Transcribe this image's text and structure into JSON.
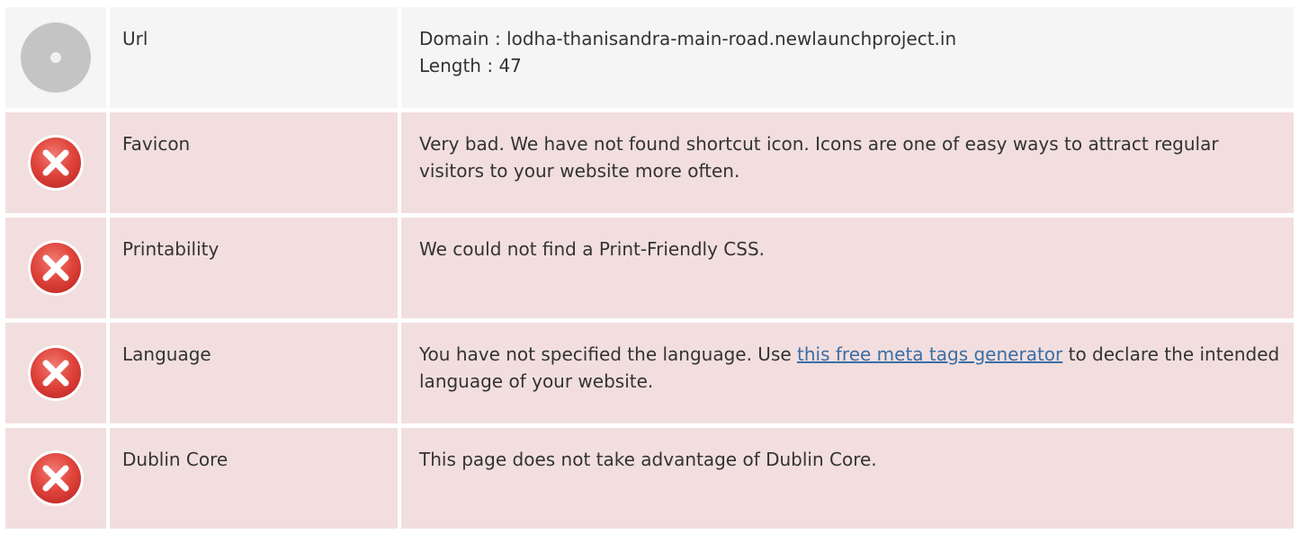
{
  "colors": {
    "neutral_bg": "#f5f5f5",
    "error_bg": "#f2dede",
    "error_icon": "#d9534f",
    "neutral_icon": "#c4c4c4",
    "link": "#3a6ea5"
  },
  "rows": [
    {
      "status": "neutral",
      "icon": "gray-circle-icon",
      "label": "Url",
      "value_lines": [
        "Domain : lodha-thanisandra-main-road.newlaunchproject.in",
        "Length : 47"
      ]
    },
    {
      "status": "error",
      "icon": "error-x-icon",
      "label": "Favicon",
      "value": "Very bad. We have not found shortcut icon. Icons are one of easy ways to attract regular visitors to your website more often."
    },
    {
      "status": "error",
      "icon": "error-x-icon",
      "label": "Printability",
      "value": "We could not find a Print-Friendly CSS."
    },
    {
      "status": "error",
      "icon": "error-x-icon",
      "label": "Language",
      "value_before": "You have not specified the language. Use ",
      "link_text": "this free meta tags generator",
      "value_after": " to declare the intended language of your website."
    },
    {
      "status": "error",
      "icon": "error-x-icon",
      "label": "Dublin Core",
      "value": "This page does not take advantage of Dublin Core."
    }
  ]
}
